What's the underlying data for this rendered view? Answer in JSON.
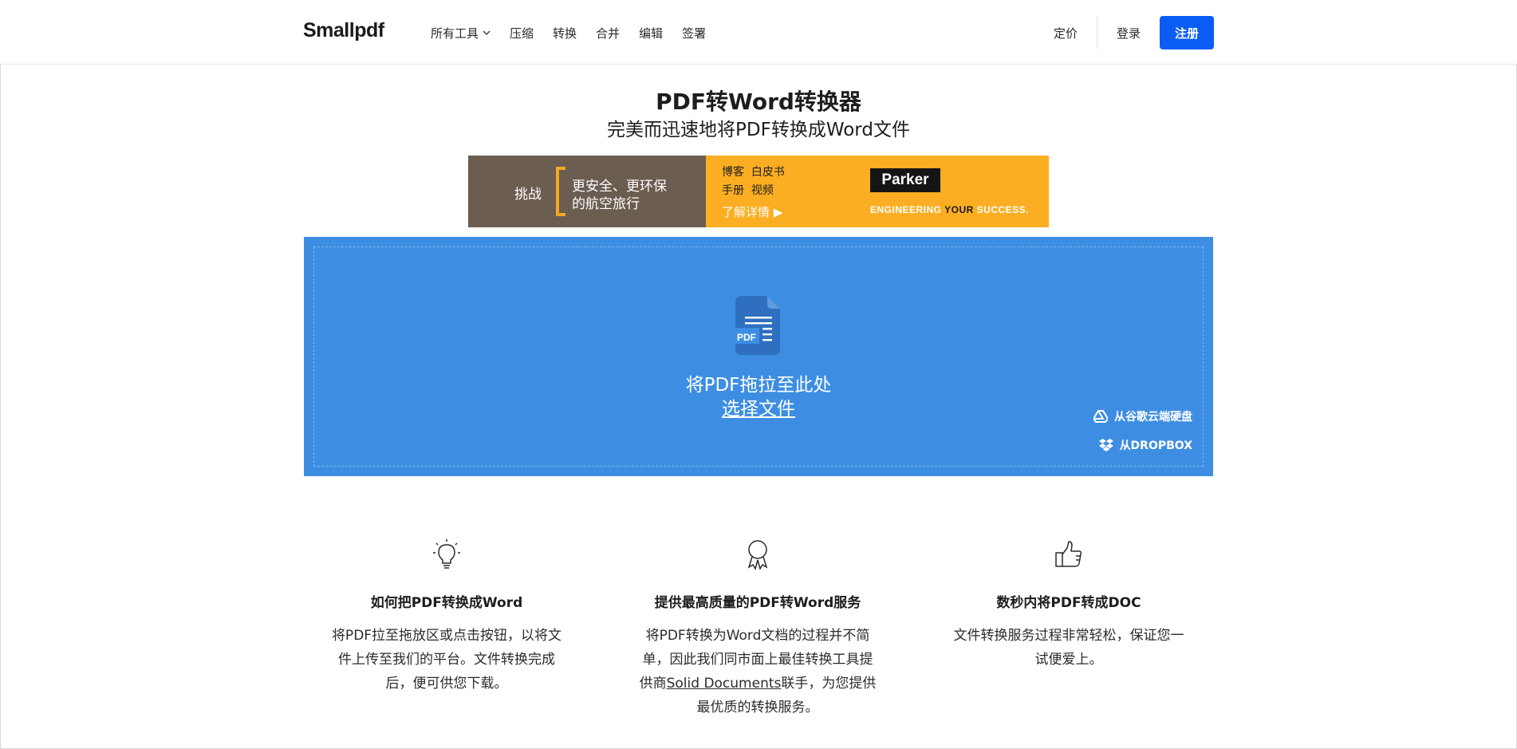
{
  "header": {
    "logo": "Smallpdf",
    "nav": [
      {
        "label": "所有工具",
        "has_dropdown": true
      },
      {
        "label": "压缩"
      },
      {
        "label": "转换"
      },
      {
        "label": "合并"
      },
      {
        "label": "编辑"
      },
      {
        "label": "签署"
      }
    ],
    "pricing": "定价",
    "login": "登录",
    "signup": "注册",
    "accent_color": "#0a5cf5"
  },
  "hero": {
    "title": "PDF转Word转换器",
    "subtitle": "完美而迅速地将PDF转换成Word文件"
  },
  "ad": {
    "challenge": "挑战",
    "tagline_1": "更安全、更环保",
    "tagline_2": "的航空旅行",
    "links_1": "博客  白皮书",
    "links_2": "手册  视频",
    "more": "了解详情 ▶",
    "brand": "Parker",
    "slogan_a": "ENGINEERING ",
    "slogan_b": "YOUR",
    "slogan_c": " SUCCESS."
  },
  "dropzone": {
    "icon_text": "PDF",
    "drop_text": "将PDF拖拉至此处",
    "choose_file": "选择文件",
    "from_gdrive": "从谷歌云端硬盘",
    "from_dropbox": "从DROPBOX",
    "bg_color": "#3d8ee3"
  },
  "features": [
    {
      "icon": "lightbulb-icon",
      "title": "如何把PDF转换成Word",
      "lines": [
        "将PDF拉至拖放区或点击按钮，以将文",
        "件上传至我们的平台。文件转换完成",
        "后，便可供您下载。"
      ]
    },
    {
      "icon": "award-ribbon-icon",
      "title": "提供最高质量的PDF转Word服务",
      "lines": [
        "将PDF转换为Word文档的过程并不简",
        "单，因此我们同市面上最佳转换工具提"
      ],
      "line3_pre": "供商",
      "line3_link": "Solid Documents",
      "line3_post": "联手，为您提供",
      "line4": "最优质的转换服务。"
    },
    {
      "icon": "thumbs-up-icon",
      "title": "数秒内将PDF转成DOC",
      "lines": [
        "文件转换服务过程非常轻松，保证您一",
        "试便爱上。"
      ]
    }
  ]
}
